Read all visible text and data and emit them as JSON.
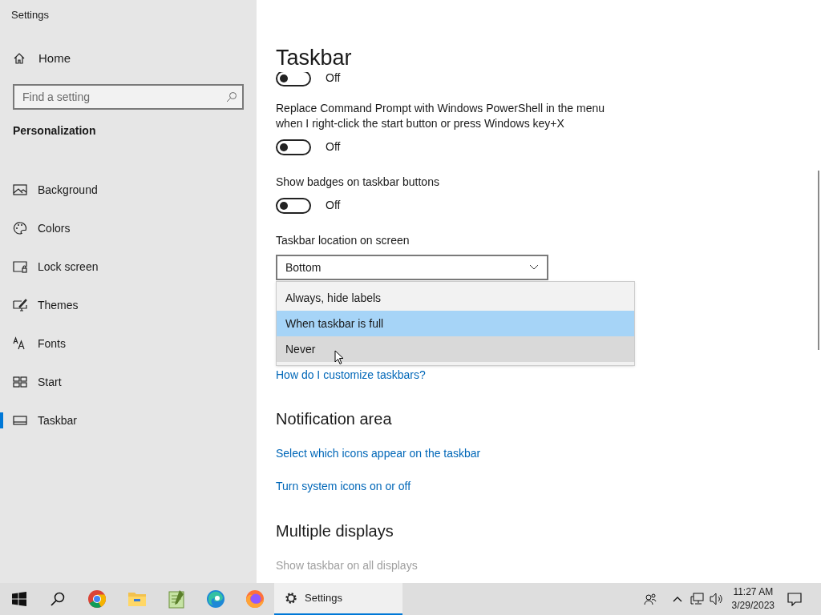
{
  "window": {
    "title": "Settings"
  },
  "sidebar": {
    "home": "Home",
    "search": {
      "placeholder": "Find a setting"
    },
    "section": "Personalization",
    "items": [
      {
        "label": "Background",
        "selected": false
      },
      {
        "label": "Colors",
        "selected": false
      },
      {
        "label": "Lock screen",
        "selected": false
      },
      {
        "label": "Themes",
        "selected": false
      },
      {
        "label": "Fonts",
        "selected": false
      },
      {
        "label": "Start",
        "selected": false
      },
      {
        "label": "Taskbar",
        "selected": true
      }
    ]
  },
  "page": {
    "title": "Taskbar",
    "settings": [
      {
        "kind": "toggle",
        "on": false,
        "state": "Off"
      },
      {
        "kind": "toggle",
        "label": "Replace Command Prompt with Windows PowerShell in the menu when I right-click the start button or press Windows key+X",
        "on": false,
        "state": "Off"
      },
      {
        "kind": "toggle",
        "label": "Show badges on taskbar buttons",
        "on": false,
        "state": "Off"
      },
      {
        "kind": "dropdown",
        "label": "Taskbar location on screen",
        "value": "Bottom"
      }
    ],
    "open_list": [
      {
        "label": "Always, hide labels",
        "selected": false,
        "hovered": false
      },
      {
        "label": "When taskbar is full",
        "selected": true,
        "hovered": false
      },
      {
        "label": "Never",
        "selected": false,
        "hovered": true
      }
    ],
    "help_link": "How do I customize taskbars?",
    "sections": [
      {
        "title": "Notification area",
        "items": [
          {
            "kind": "link",
            "label": "Select which icons appear on the taskbar"
          },
          {
            "kind": "link",
            "label": "Turn system icons on or off"
          }
        ]
      },
      {
        "title": "Multiple displays",
        "items": [
          {
            "kind": "label",
            "label": "Show taskbar on all displays",
            "disabled": true
          }
        ]
      }
    ]
  },
  "taskbar": {
    "apps": [
      {
        "kind": "start"
      },
      {
        "kind": "search"
      },
      {
        "kind": "chrome"
      },
      {
        "kind": "explorer"
      },
      {
        "kind": "notepad"
      },
      {
        "kind": "edge"
      },
      {
        "kind": "firefox"
      },
      {
        "kind": "settings",
        "label": "Settings",
        "active": true
      }
    ],
    "time": "11:27 AM",
    "date": "3/29/2023"
  }
}
